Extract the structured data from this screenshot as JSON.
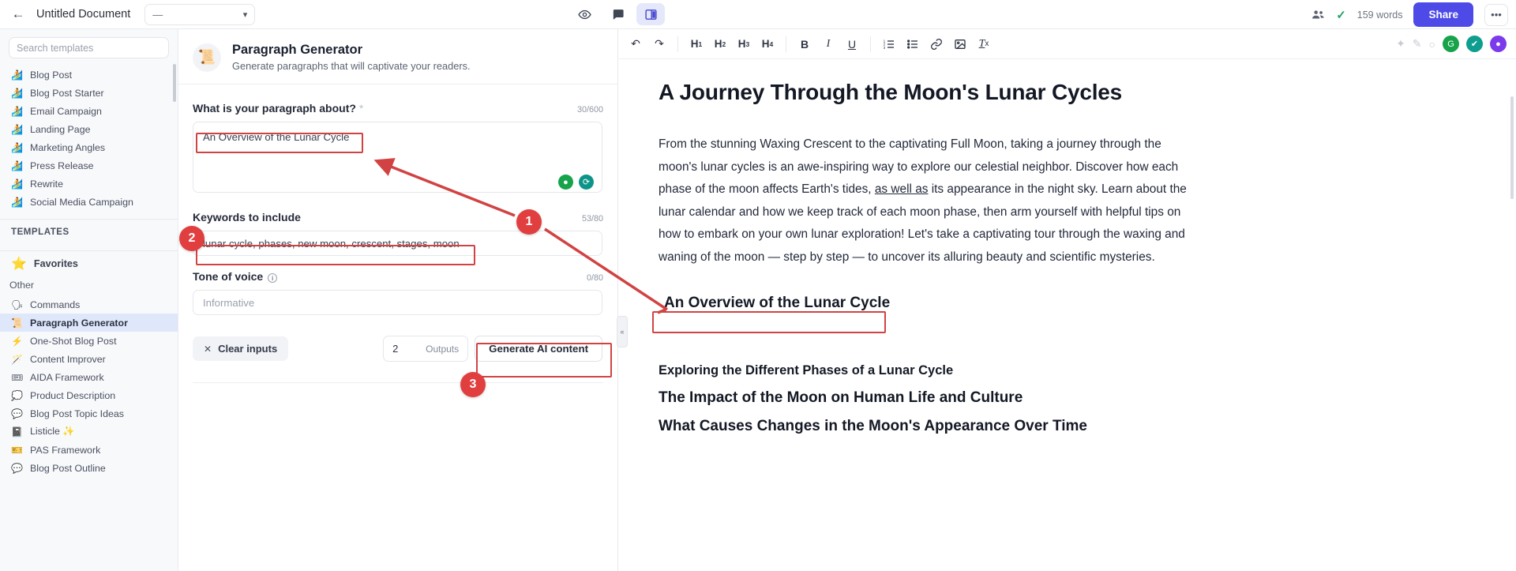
{
  "topbar": {
    "back_icon": "arrow-left-icon",
    "document_title": "Untitled Document",
    "mode_select_value": "—",
    "chevron_icon": "chevron-down-icon",
    "center_tools": [
      {
        "name": "preview-eye-icon",
        "glyph": "◉",
        "active": false
      },
      {
        "name": "comment-icon",
        "glyph": "◑",
        "active": false
      },
      {
        "name": "split-view-icon",
        "glyph": "▤",
        "active": true
      }
    ],
    "collaborators_icon": "people-icon",
    "saved_check_icon": "check-icon",
    "word_count": "159 words",
    "share_label": "Share",
    "more_label": "•••"
  },
  "sidebar": {
    "search_placeholder": "Search templates",
    "recent_items": [
      {
        "emoji": "🏄",
        "label": "Blog Post"
      },
      {
        "emoji": "🏄",
        "label": "Blog Post Starter"
      },
      {
        "emoji": "🏄",
        "label": "Email Campaign"
      },
      {
        "emoji": "🏄",
        "label": "Landing Page"
      },
      {
        "emoji": "🏄",
        "label": "Marketing Angles"
      },
      {
        "emoji": "🏄",
        "label": "Press Release"
      },
      {
        "emoji": "🏄",
        "label": "Rewrite"
      },
      {
        "emoji": "🏄",
        "label": "Social Media Campaign"
      }
    ],
    "section_title": "TEMPLATES",
    "favorites_label": "Favorites",
    "favorites_icon": "star-icon",
    "other_label": "Other",
    "template_items": [
      {
        "emoji": "🗣",
        "label": "Commands",
        "selected": false
      },
      {
        "emoji": "📜",
        "label": "Paragraph Generator",
        "selected": true
      },
      {
        "emoji": "⚡",
        "label": "One-Shot Blog Post",
        "selected": false
      },
      {
        "emoji": "🪄",
        "label": "Content Improver",
        "selected": false
      },
      {
        "emoji": "🎟",
        "label": "AIDA Framework",
        "selected": false
      },
      {
        "emoji": "💭",
        "label": "Product Description",
        "selected": false
      },
      {
        "emoji": "💬",
        "label": "Blog Post Topic Ideas",
        "selected": false
      },
      {
        "emoji": "📓",
        "label": "Listicle ✨",
        "selected": false
      },
      {
        "emoji": "🎫",
        "label": "PAS Framework",
        "selected": false
      },
      {
        "emoji": "💬",
        "label": "Blog Post Outline",
        "selected": false
      }
    ]
  },
  "form": {
    "header_emoji": "📜",
    "title": "Paragraph Generator",
    "subtitle": "Generate paragraphs that will captivate your readers.",
    "paragraph_about": {
      "label": "What is your paragraph about?",
      "required_mark": "*",
      "counter": "30/600",
      "value": "An Overview of the Lunar Cycle",
      "action_icons": [
        {
          "name": "sparkle-suggest-icon",
          "glyph": "◕",
          "color": "#16a34a"
        },
        {
          "name": "refresh-icon",
          "glyph": "⟳",
          "color": "#0d9488"
        }
      ]
    },
    "keywords": {
      "label": "Keywords to include",
      "counter": "53/80",
      "value": "lunar cycle, phases, new moon, crescent, stages, moon"
    },
    "tone": {
      "label": "Tone of voice",
      "info_icon": "info-icon",
      "counter": "0/80",
      "placeholder": "Informative",
      "value": ""
    },
    "clear_label": "Clear inputs",
    "clear_icon": "close-x-icon",
    "outputs_value": "2",
    "outputs_label": "Outputs",
    "generate_label": "Generate AI content"
  },
  "editor": {
    "toolbar": {
      "undo_icon": "undo-icon",
      "redo_icon": "redo-icon",
      "headings": [
        "H1",
        "H2",
        "H3",
        "H4"
      ],
      "bold_label": "B",
      "italic_label": "I",
      "underline_label": "U",
      "ordered_list_icon": "ordered-list-icon",
      "bullet_list_icon": "bullet-list-icon",
      "link_icon": "link-icon",
      "image_icon": "image-icon",
      "clear_format_icon": "clear-formatting-icon",
      "right_icons": [
        {
          "name": "magic-wand-icon",
          "glyph": "✦",
          "style": "gray"
        },
        {
          "name": "pen-icon",
          "glyph": "✎",
          "style": "gray"
        },
        {
          "name": "mood-icon",
          "glyph": "○",
          "style": "gray"
        },
        {
          "name": "grammarly-icon",
          "glyph": "G",
          "style": "green"
        },
        {
          "name": "shield-check-icon",
          "glyph": "✔",
          "style": "teal"
        },
        {
          "name": "account-avatar",
          "glyph": "◉",
          "style": "purple"
        }
      ]
    },
    "title": "A Journey Through the Moon's Lunar Cycles",
    "paragraph_parts": {
      "before": "From the stunning Waxing Crescent to the captivating Full Moon, taking a journey through the moon's lunar cycles is an awe-inspiring way to explore our celestial neighbor. Discover how each phase of the moon affects Earth's tides, ",
      "underlined": "as well as",
      "after": " its appearance in the night sky. Learn about the lunar calendar and how we keep track of each moon phase, then arm yourself with helpful tips on how to embark on your own lunar exploration! Let's take a captivating tour through the waxing and waning of the moon — step by step — to uncover its alluring beauty and scientific mysteries."
    },
    "inserted_heading": "An Overview of the Lunar Cycle",
    "subheadings": [
      "Exploring the Different Phases of a Lunar Cycle",
      "The Impact of the Moon on Human Life and Culture",
      "What Causes Changes in the Moon's Appearance Over Time"
    ],
    "collapse_icon": "collapse-panel-icon"
  },
  "annotations": {
    "accent_color": "#e13f3f",
    "steps": [
      {
        "number": "1",
        "target": "paragraph-about-input"
      },
      {
        "number": "2",
        "target": "keywords-input"
      },
      {
        "number": "3",
        "target": "generate-ai-content-button"
      }
    ]
  }
}
